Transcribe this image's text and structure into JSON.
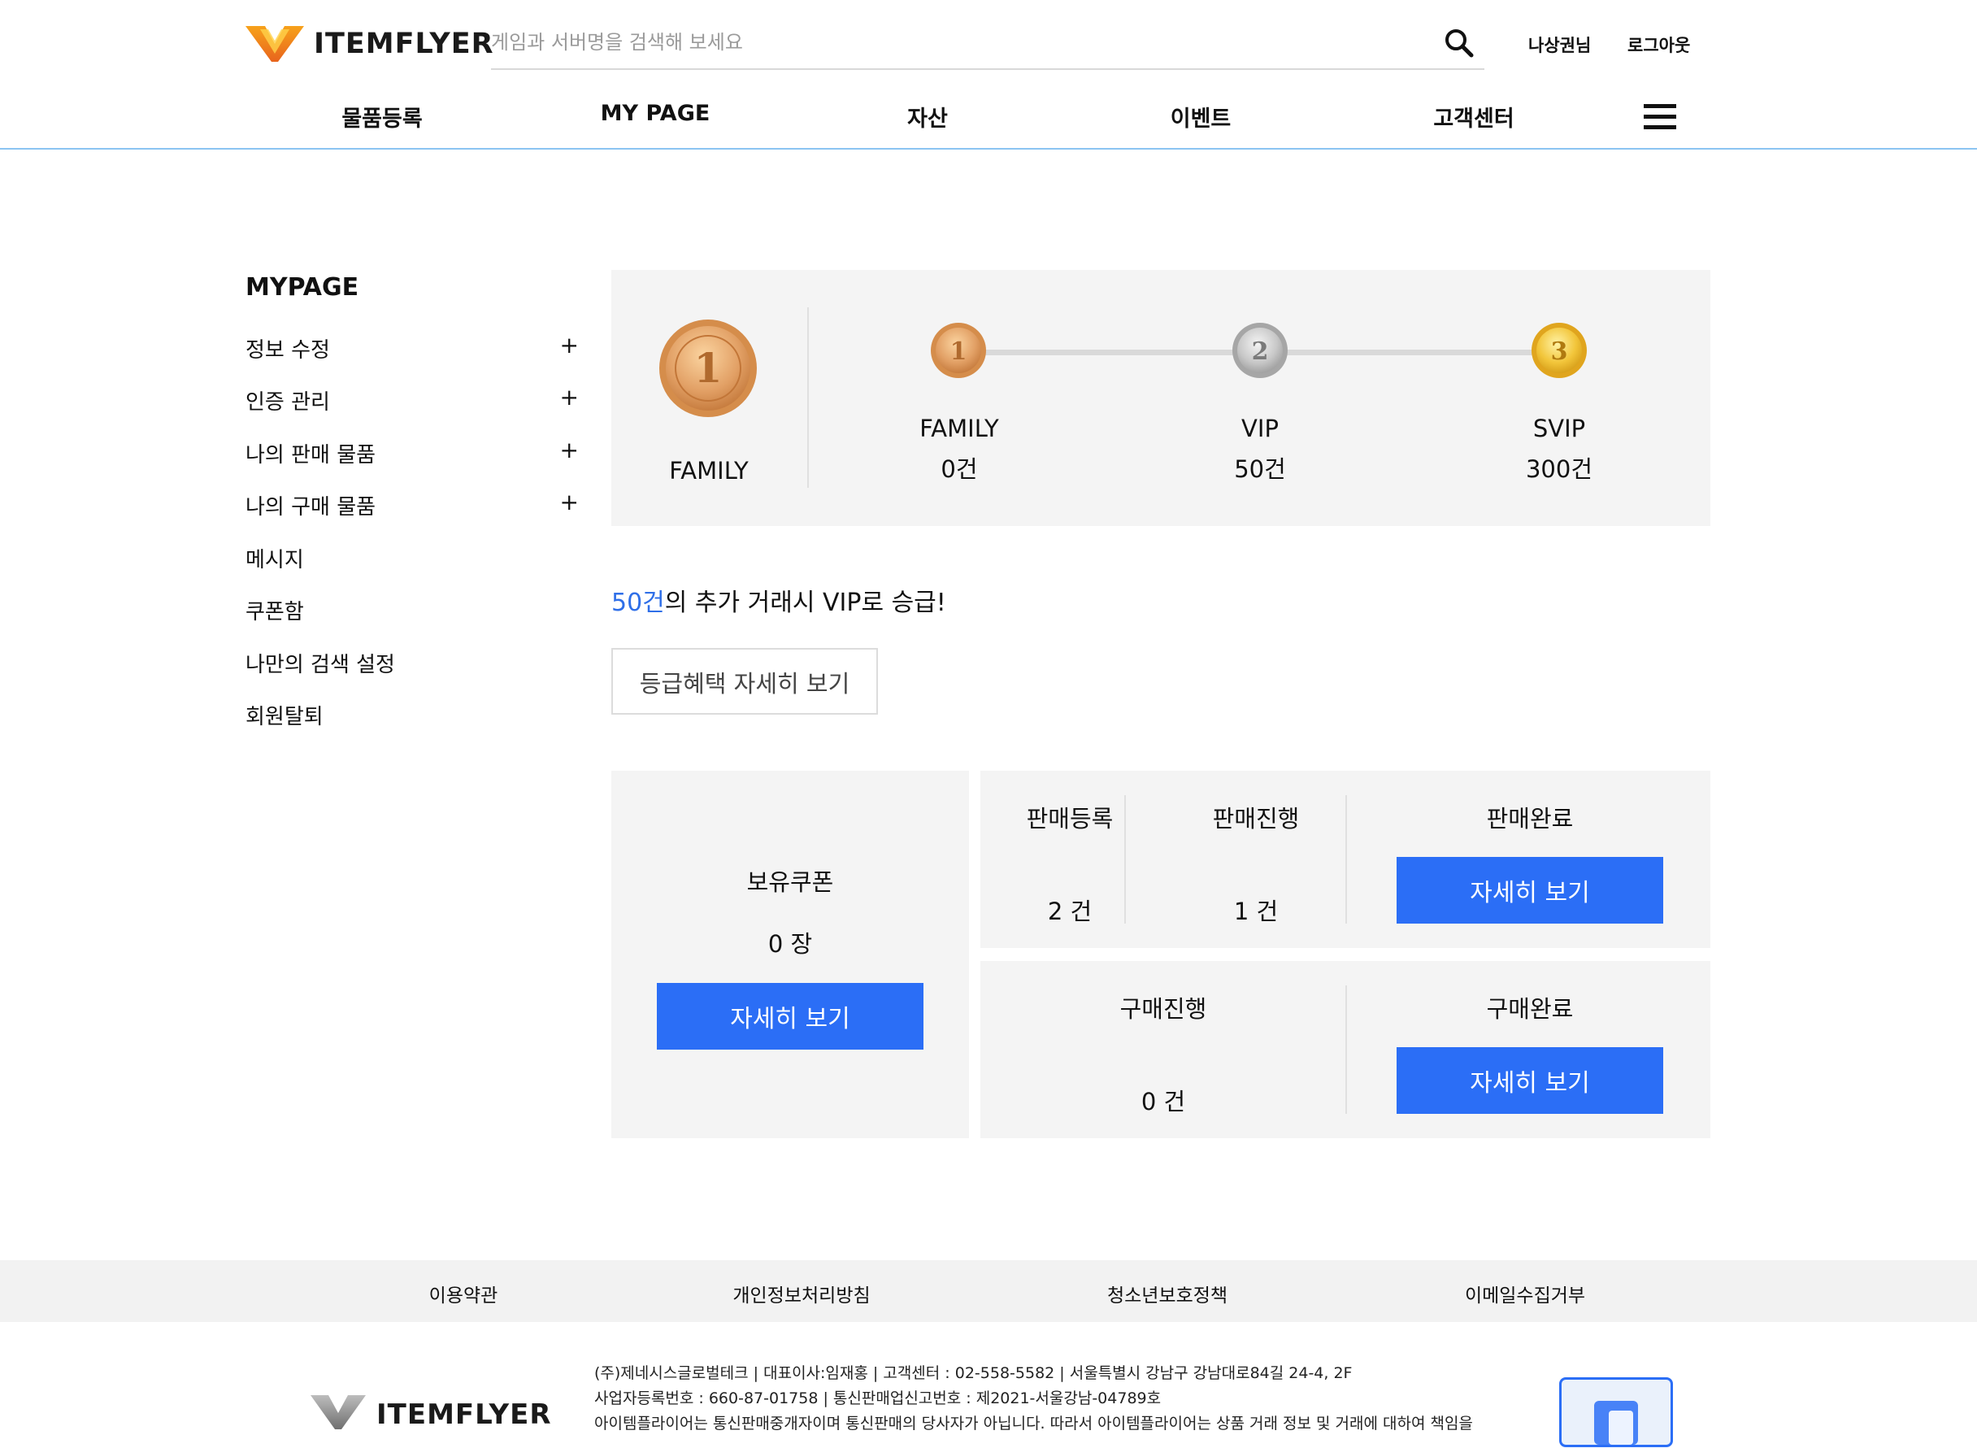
{
  "brand": {
    "name": "ITEMFLYER"
  },
  "search": {
    "placeholder": "게임과 서버명을 검색해 보세요"
  },
  "user": {
    "name": "나상권님",
    "logout_label": "로그아웃"
  },
  "nav": {
    "items": [
      {
        "label": "물품등록"
      },
      {
        "label": "MY PAGE"
      },
      {
        "label": "자산"
      },
      {
        "label": "이벤트"
      },
      {
        "label": "고객센터"
      }
    ]
  },
  "sidebar": {
    "title": "MYPAGE",
    "items": [
      {
        "label": "정보 수정",
        "expand": "+"
      },
      {
        "label": "인증 관리",
        "expand": "+"
      },
      {
        "label": "나의 판매 물품",
        "expand": "+"
      },
      {
        "label": "나의 구매 물품",
        "expand": "+"
      },
      {
        "label": "메시지"
      },
      {
        "label": "쿠폰함"
      },
      {
        "label": "나만의 검색 설정"
      },
      {
        "label": "회원탈퇴"
      }
    ]
  },
  "grade": {
    "current": {
      "label": "FAMILY",
      "medal_number": "1"
    },
    "levels": [
      {
        "label": "FAMILY",
        "count": "0건",
        "medal_number": "1"
      },
      {
        "label": "VIP",
        "count": "50건",
        "medal_number": "2"
      },
      {
        "label": "SVIP",
        "count": "300건",
        "medal_number": "3"
      }
    ]
  },
  "promo": {
    "highlight": "50건",
    "text": "의 추가 거래시 VIP로 승급!"
  },
  "benefit_button": {
    "label": "등급혜택 자세히 보기"
  },
  "coupon": {
    "label": "보유쿠폰",
    "value": "0 장",
    "button": "자세히 보기"
  },
  "sales": {
    "registered": {
      "label": "판매등록",
      "value": "2 건"
    },
    "in_progress": {
      "label": "판매진행",
      "value": "1 건"
    },
    "completed": {
      "label": "판매완료",
      "button": "자세히 보기"
    }
  },
  "purchases": {
    "in_progress": {
      "label": "구매진행",
      "value": "0 건"
    },
    "completed": {
      "label": "구매완료",
      "button": "자세히 보기"
    }
  },
  "footer": {
    "links": [
      {
        "label": "이용약관"
      },
      {
        "label": "개인정보처리방침"
      },
      {
        "label": "청소년보호정책"
      },
      {
        "label": "이메일수집거부"
      }
    ],
    "info_lines": [
      "(주)제네시스글로벌테크 | 대표이사:임재홍 | 고객센터 : 02-558-5582 | 서울특별시 강남구 강남대로84길 24-4, 2F",
      "사업자등록번호 : 660-87-01758 | 통신판매업신고번호 : 제2021-서울강남-04789호",
      "아이템플라이어는 통신판매중개자이며 통신판매의 당사자가 아닙니다. 따라서 아이템플라이어는 상품 거래 정보 및 거래에 대하여 책임을"
    ]
  },
  "colors": {
    "accent": "#2b6ef6",
    "highlight": "#2f6fe8",
    "panel_bg": "#f4f4f4",
    "header_border": "#8cc4f2"
  }
}
